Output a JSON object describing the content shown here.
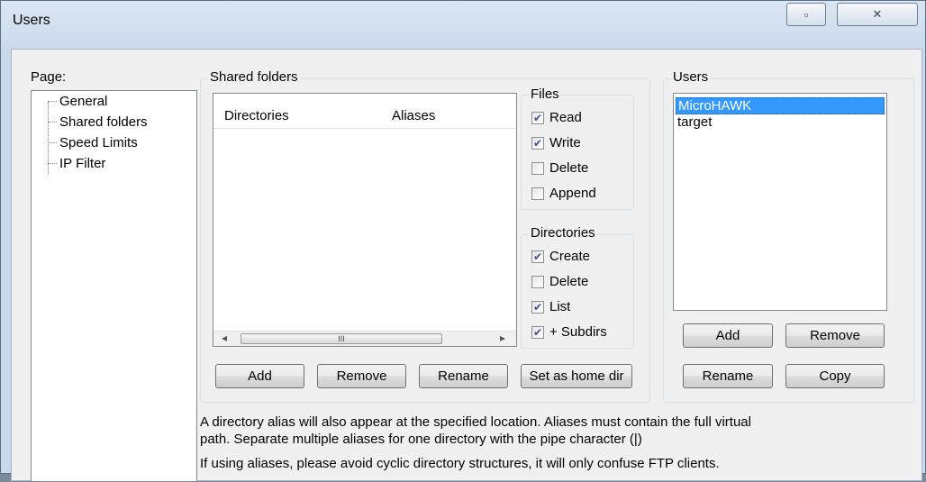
{
  "window": {
    "title": "Users",
    "restore_glyph": "▫",
    "close_glyph": "✕"
  },
  "page_panel": {
    "label": "Page:",
    "items": [
      "General",
      "Shared folders",
      "Speed Limits",
      "IP Filter"
    ]
  },
  "shared": {
    "label": "Shared folders",
    "columns": [
      "Directories",
      "Aliases"
    ],
    "scroll_left": "◂",
    "scroll_right": "▸",
    "scroll_grip": "III",
    "buttons": {
      "add": "Add",
      "remove": "Remove",
      "rename": "Rename",
      "home": "Set as home dir"
    }
  },
  "files": {
    "label": "Files",
    "options": [
      {
        "label": "Read",
        "checked": true
      },
      {
        "label": "Write",
        "checked": true
      },
      {
        "label": "Delete",
        "checked": false
      },
      {
        "label": "Append",
        "checked": false
      }
    ]
  },
  "directories": {
    "label": "Directories",
    "options": [
      {
        "label": "Create",
        "checked": true
      },
      {
        "label": "Delete",
        "checked": false
      },
      {
        "label": "List",
        "checked": true
      },
      {
        "label": "+ Subdirs",
        "checked": true
      }
    ]
  },
  "users": {
    "label": "Users",
    "list": [
      "MicroHAWK",
      "target"
    ],
    "selected": "MicroHAWK",
    "buttons": {
      "add": "Add",
      "remove": "Remove",
      "rename": "Rename",
      "copy": "Copy"
    }
  },
  "info": {
    "line1": "A directory alias will also appear at the specified location. Aliases must contain the full virtual",
    "line2": "path. Separate multiple aliases for one directory with the pipe character (|)",
    "line3": "If using aliases, please avoid cyclic directory structures, it will only confuse FTP clients."
  },
  "colors": {
    "selection": "#3399ff",
    "accent_check": "#3d4f8c"
  }
}
